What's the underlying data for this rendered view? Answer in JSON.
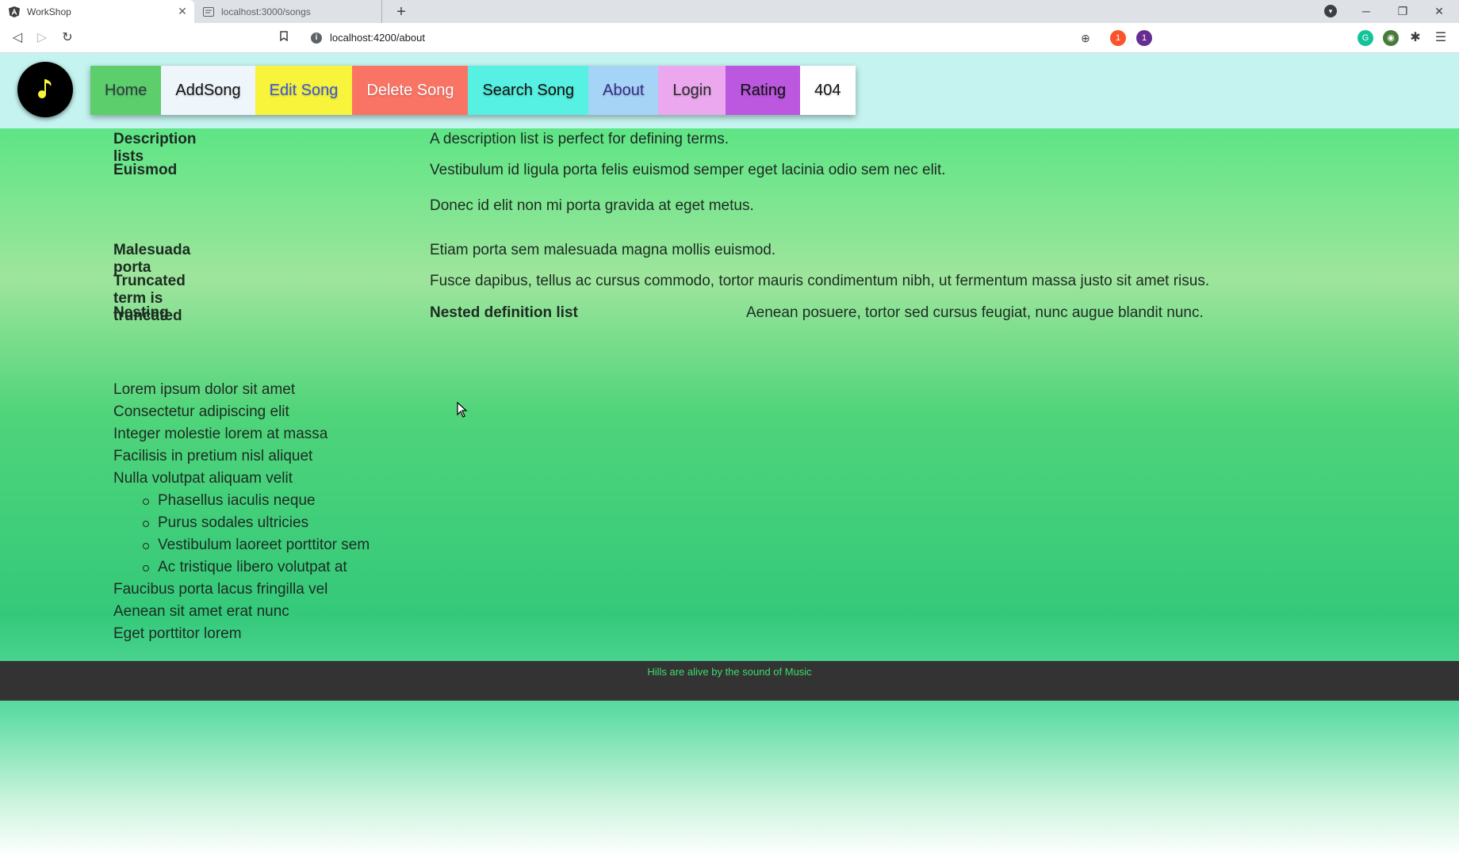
{
  "browser": {
    "tabs": [
      {
        "title": "WorkShop",
        "active": true
      },
      {
        "title": "localhost:3000/songs",
        "active": false
      }
    ],
    "url": "localhost:4200/about",
    "shield_badge": "1",
    "triangle_badge": "1"
  },
  "header": {
    "logo_icon": "music-note-icon",
    "nav": [
      {
        "label": "Home",
        "bg": "#5ccf6c",
        "fg": "#2f3a44"
      },
      {
        "label": "AddSong",
        "bg": "#eef5fb",
        "fg": "#111111"
      },
      {
        "label": "Edit Song",
        "bg": "#f8f43c",
        "fg": "#3b57d8"
      },
      {
        "label": "Delete Song",
        "bg": "#fa7465",
        "fg": "#ffffff"
      },
      {
        "label": "Search Song",
        "bg": "#56f1e2",
        "fg": "#111111"
      },
      {
        "label": "About",
        "bg": "#a6d4f6",
        "fg": "#3a2e8c"
      },
      {
        "label": "Login",
        "bg": "#eba8ee",
        "fg": "#2b2b2b"
      },
      {
        "label": "Rating",
        "bg": "#bc58e0",
        "fg": "#111111"
      },
      {
        "label": "404",
        "bg": "#ffffff",
        "fg": "#111111"
      }
    ]
  },
  "description_list": {
    "rows": [
      {
        "term": "Description lists",
        "desc": "A description list is perfect for defining terms."
      },
      {
        "term": "Euismod",
        "desc": "Vestibulum id ligula porta felis euismod semper eget lacinia odio sem nec elit.",
        "desc2": "Donec id elit non mi porta gravida at eget metus."
      },
      {
        "term": "Malesuada porta",
        "desc": "Etiam porta sem malesuada magna mollis euismod."
      },
      {
        "term": "Truncated term is truncated",
        "desc": "Fusce dapibus, tellus ac cursus commodo, tortor mauris condimentum nibh, ut fermentum massa justo sit amet risus."
      },
      {
        "term": "Nesting",
        "nested_term": "Nested definition list",
        "nested_desc": "Aenean posuere, tortor sed cursus feugiat, nunc augue blandit nunc."
      }
    ]
  },
  "list": {
    "items": [
      "Lorem ipsum dolor sit amet",
      "Consectetur adipiscing elit",
      "Integer molestie lorem at massa",
      "Facilisis in pretium nisl aliquet",
      "Nulla volutpat aliquam velit"
    ],
    "sub_items": [
      "Phasellus iaculis neque",
      "Purus sodales ultricies",
      "Vestibulum laoreet porttitor sem",
      "Ac tristique libero volutpat at"
    ],
    "tail_items": [
      "Faucibus porta lacus fringilla vel",
      "Aenean sit amet erat nunc",
      "Eget porttitor lorem"
    ]
  },
  "footer": {
    "text": "Hills are alive by the sound of Music"
  }
}
